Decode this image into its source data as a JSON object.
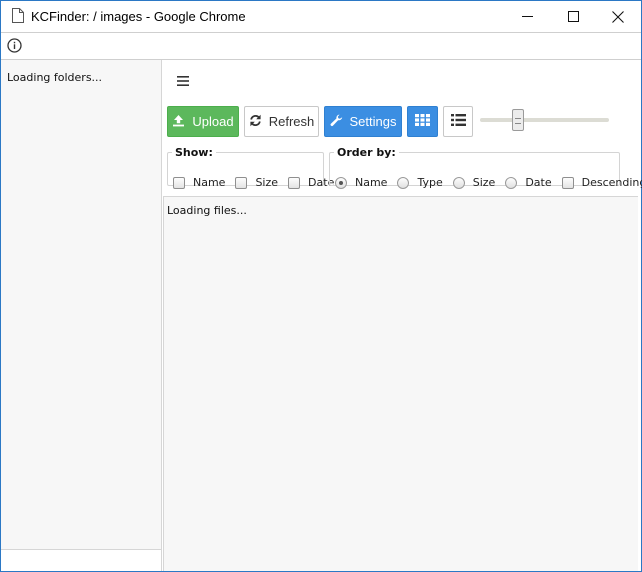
{
  "window": {
    "title": "KCFinder: / images - Google Chrome"
  },
  "icons": {
    "document": "document-icon",
    "minimize": "minimize-icon",
    "maximize": "maximize-icon",
    "close": "close-icon",
    "info": "info-icon",
    "menu": "hamburger-menu-icon",
    "upload": "upload-icon",
    "refresh": "refresh-icon",
    "settings": "wrench-icon",
    "grid": "grid-view-icon",
    "list": "list-view-icon"
  },
  "colors": {
    "upload": "#5cb85c",
    "settings": "#3b8ee2",
    "window_border": "#2b78c5"
  },
  "folders": {
    "loading_text": "Loading folders..."
  },
  "toolbar": {
    "upload_label": "Upload",
    "refresh_label": "Refresh",
    "settings_label": "Settings"
  },
  "show": {
    "legend": "Show:",
    "options": [
      {
        "label": "Name",
        "checked": false
      },
      {
        "label": "Size",
        "checked": false
      },
      {
        "label": "Date",
        "checked": false
      }
    ]
  },
  "order": {
    "legend": "Order by:",
    "options": [
      {
        "label": "Name",
        "selected": true
      },
      {
        "label": "Type",
        "selected": false
      },
      {
        "label": "Size",
        "selected": false
      },
      {
        "label": "Date",
        "selected": false
      }
    ],
    "descending_label": "Descending",
    "descending_checked": false
  },
  "files": {
    "loading_text": "Loading files..."
  }
}
